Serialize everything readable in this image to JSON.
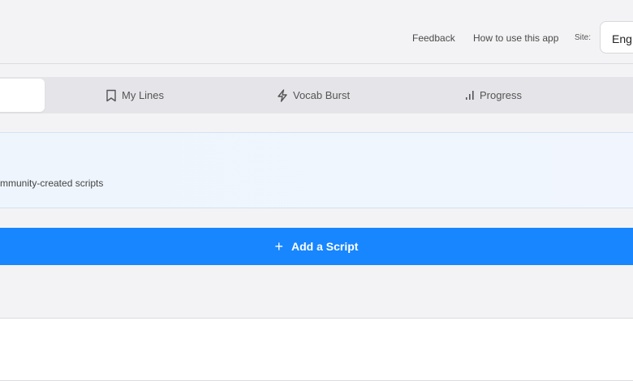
{
  "header": {
    "feedback": "Feedback",
    "how_to": "How to use this app",
    "site_label": "Site:",
    "language": "Eng"
  },
  "tabs": [
    {
      "label": "",
      "icon": "search-icon",
      "active": true
    },
    {
      "label": "My Lines",
      "icon": "bookmark-icon"
    },
    {
      "label": "Vocab Burst",
      "icon": "lightning-icon"
    },
    {
      "label": "Progress",
      "icon": "bar-chart-icon"
    }
  ],
  "info_card": {
    "text": "mmunity-created scripts"
  },
  "add_button": {
    "icon": "plus-icon",
    "label": "Add a Script"
  },
  "colors": {
    "accent": "#1786ff",
    "background": "#f3f3f5",
    "tab_bar": "#e5e5e9",
    "info_card": "#eef5fd"
  }
}
